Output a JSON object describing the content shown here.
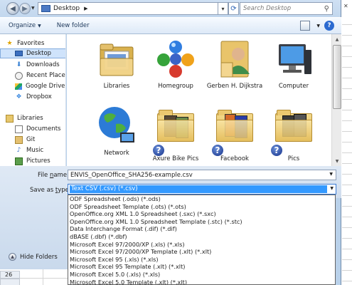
{
  "address": {
    "location": "Desktop",
    "search_placeholder": "Search Desktop"
  },
  "toolbar": {
    "organize": "Organize",
    "new_folder": "New folder"
  },
  "sidebar": {
    "favorites_label": "Favorites",
    "favorites": [
      "Desktop",
      "Downloads",
      "Recent Places",
      "Google Drive",
      "Dropbox"
    ],
    "libraries_label": "Libraries",
    "libraries": [
      "Documents",
      "Git",
      "Music",
      "Pictures"
    ],
    "hide_folders": "Hide Folders"
  },
  "tiles": [
    {
      "label": "Libraries"
    },
    {
      "label": "Homegroup"
    },
    {
      "label": "Gerben H. Dijkstra"
    },
    {
      "label": "Computer"
    },
    {
      "label": "Network"
    },
    {
      "label": "Axure Bike Pics"
    },
    {
      "label": "Facebook"
    },
    {
      "label": "Pics"
    }
  ],
  "form": {
    "file_name_label_pre": "File ",
    "file_name_label_u": "n",
    "file_name_label_post": "ame:",
    "file_name_value": "ENVIS_OpenOffice_SHA256-example.csv",
    "save_as_label_pre": "Save as ",
    "save_as_label_u": "t",
    "save_as_label_post": "ype:",
    "save_as_value": "Text CSV (.csv) (*.csv)"
  },
  "type_options": [
    "ODF Spreadsheet (.ods) (*.ods)",
    "ODF Spreadsheet Template (.ots) (*.ots)",
    "OpenOffice.org XML 1.0 Spreadsheet (.sxc) (*.sxc)",
    "OpenOffice.org XML 1.0 Spreadsheet Template (.stc) (*.stc)",
    "Data Interchange Format (.dif) (*.dif)",
    "dBASE (.dbf) (*.dbf)",
    "Microsoft Excel 97/2000/XP (.xls) (*.xls)",
    "Microsoft Excel 97/2000/XP Template (.xlt) (*.xlt)",
    "Microsoft Excel 95 (.xls) (*.xls)",
    "Microsoft Excel 95 Template (.xlt) (*.xlt)",
    "Microsoft Excel 5.0 (.xls) (*.xls)",
    "Microsoft Excel 5.0 Template (.xlt) (*.xlt)"
  ],
  "sheet": {
    "row_number": "26"
  }
}
